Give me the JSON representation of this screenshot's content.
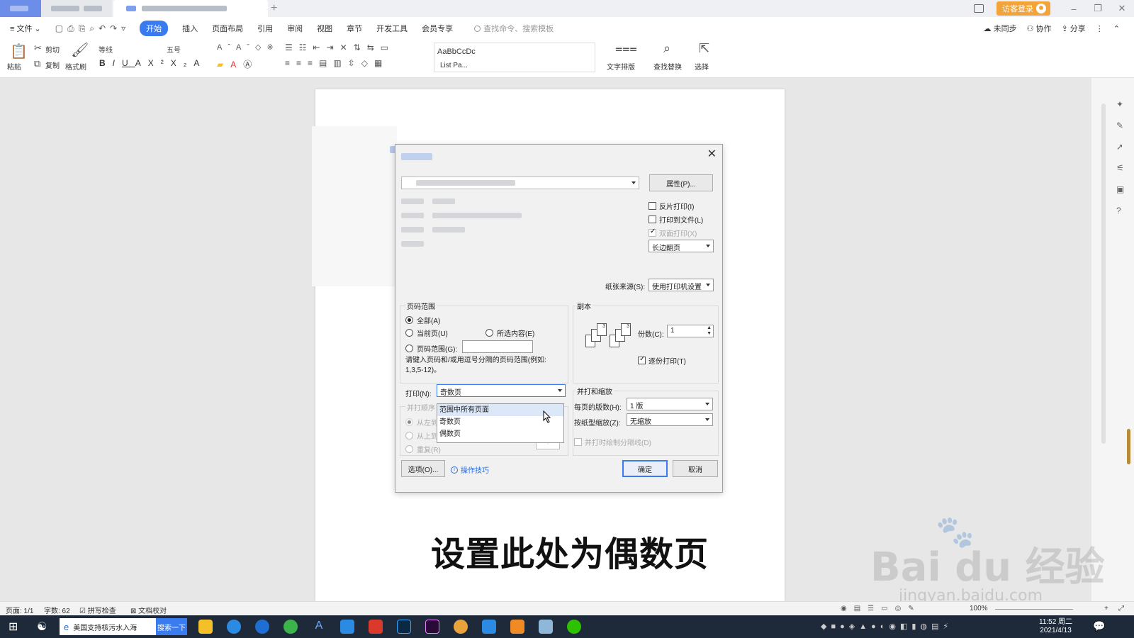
{
  "titlebar": {
    "guest_label": "访客登录"
  },
  "menu": {
    "file": "文件",
    "tabs": [
      "开始",
      "插入",
      "页面布局",
      "引用",
      "审阅",
      "视图",
      "章节",
      "开发工具",
      "会员专享"
    ],
    "search_placeholder": "查找命令、搜索模板",
    "right": [
      "未同步",
      "协作",
      "分享"
    ]
  },
  "ribbon": {
    "paste": "粘贴",
    "cut": "剪切",
    "copy": "复制",
    "format_painter": "格式刷",
    "font_name": "等线",
    "font_size": "五号",
    "style_preview": "AaBbCcDc",
    "style_name": "List Pa...",
    "text_layout": "文字排版",
    "find_replace": "查找替换",
    "select": "选择"
  },
  "dialog": {
    "properties_btn": "属性(P)...",
    "reverse_print": "反片打印(I)",
    "print_to_file": "打印到文件(L)",
    "duplex_print": "双面打印(X)",
    "duplex_mode": "长边翻页",
    "paper_source_label": "纸张来源(S):",
    "paper_source_value": "使用打印机设置",
    "page_range": {
      "title": "页码范围",
      "all": "全部(A)",
      "current": "当前页(U)",
      "selection": "所选内容(E)",
      "range": "页码范围(G):",
      "hint_line1": "请键入页码和/或用逗号分隔的页码范围(例如:",
      "hint_line2": "1,3,5-12)。"
    },
    "print_label": "打印(N):",
    "print_value": "奇数页",
    "print_options": [
      "范围中所有页面",
      "奇数页",
      "偶数页"
    ],
    "collate_title": "并打顺序",
    "collate_opts": [
      "从左到右(F)",
      "从上到下(B)",
      "重复(R)"
    ],
    "copies": {
      "title": "副本",
      "count_label": "份数(C):",
      "count_value": "1",
      "collate": "逐份打印(T)"
    },
    "zoom": {
      "title": "并打和缩放",
      "pages_per_sheet_label": "每页的版数(H):",
      "pages_per_sheet_value": "1 版",
      "scale_label": "按纸型缩放(Z):",
      "scale_value": "无缩放",
      "draw_lines": "并打时绘制分隔线(D)"
    },
    "options_btn": "选项(O)...",
    "tips_link": "操作技巧",
    "ok": "确定",
    "cancel": "取消"
  },
  "caption": "设置此处为偶数页",
  "watermark": {
    "brand": "Bai du 经验",
    "url": "jingyan.baidu.com"
  },
  "status": {
    "page": "页面: 1/1",
    "words": "字数: 62",
    "spell": "拼写检查",
    "proof": "文档校对",
    "zoom": "100%"
  },
  "taskbar": {
    "search_text": "美国支持核污水入海",
    "search_btn": "搜索一下",
    "time": "11:52 周二",
    "date": "2021/4/13"
  }
}
